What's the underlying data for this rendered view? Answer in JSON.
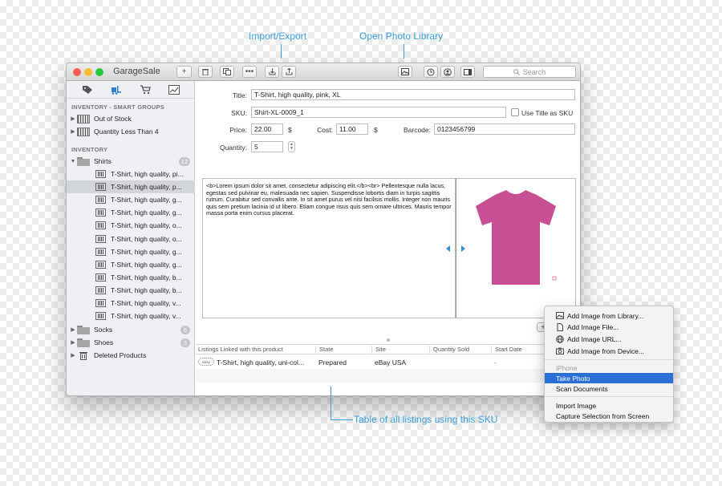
{
  "callouts": {
    "import_export": "Import/Export",
    "open_photo_library": "Open Photo Library",
    "table_of_listings": "Table of all listings using this SKU"
  },
  "window": {
    "app_title": "GarageSale",
    "search_placeholder": "Search",
    "traffic_colors": [
      "#fc5f57",
      "#fdbc2e",
      "#27c840"
    ]
  },
  "sidebar": {
    "smart_groups_header": "INVENTORY - SMART GROUPS",
    "smart_groups": [
      {
        "label": "Out of Stock"
      },
      {
        "label": "Quantity Less Than 4"
      }
    ],
    "inventory_header": "INVENTORY",
    "folders": {
      "shirts": {
        "label": "Shirts",
        "count": "12"
      },
      "socks": {
        "label": "Socks",
        "count": "6"
      },
      "shoes": {
        "label": "Shoes",
        "count": "3"
      },
      "deleted": {
        "label": "Deleted Products"
      }
    },
    "shirt_items": [
      "T-Shirt, high quality, pi...",
      "T-Shirt, high quality, p...",
      "T-Shirt, high quality, g...",
      "T-Shirt, high quality, g...",
      "T-Shirt, high quality, o...",
      "T-Shirt, high quality, o...",
      "T-Shirt, high quality, g...",
      "T-Shirt, high quality, g...",
      "T-Shirt, high quality, b...",
      "T-Shirt, high quality, b...",
      "T-Shirt, high quality, v...",
      "T-Shirt, high quality, v..."
    ]
  },
  "form": {
    "title_label": "Title:",
    "title_value": "T-Shirt, high quality, pink, XL",
    "sku_label": "SKU:",
    "sku_value": "Shirt-XL-0009_1",
    "use_title_as_sku": "Use Title as SKU",
    "price_label": "Price:",
    "price_value": "22.00",
    "currency": "$",
    "cost_label": "Cost:",
    "cost_value": "11.00",
    "barcode_label": "Barcode:",
    "barcode_value": "0123456799",
    "quantity_label": "Quantity:",
    "quantity_value": "5"
  },
  "description": {
    "text": "<b>Lorem ipsum dolor sit amet, consectetur adipiscing elit.</b><br> Pellentesque nulla lacus, egestas sed pulvinar eu, malesuada nec sapien. Suspendisse lobortis diam in turpis sagittis rutrum. Curabitur sed convallis ante. In sit amet purus vel nisi facilisis mollis. Integer non mauris quis sem pretium lacinia id ut libero. Etiam congue risus quis sem ornare ultrices. Mauris tempor massa porta enim cursus placerat."
  },
  "product_image": {
    "color": "#c94f94",
    "description": "pink t-shirt"
  },
  "listings_table": {
    "headers": [
      "Listings Linked with this product",
      "State",
      "Site",
      "Quantity Sold",
      "Start Date"
    ],
    "rows": [
      {
        "icon": "ebay",
        "title": "T-Shirt, high quality, uni-col...",
        "state": "Prepared",
        "site": "eBay USA",
        "quantity_sold": "",
        "start_date": "-"
      }
    ]
  },
  "context_menu": {
    "items_top": [
      {
        "label": "Add Image from Library..."
      },
      {
        "label": "Add Image File..."
      },
      {
        "label": "Add Image URL..."
      },
      {
        "label": "Add Image from Device..."
      }
    ],
    "device_header": "iPhone",
    "device_items": [
      "Take Photo",
      "Scan Documents"
    ],
    "items_bottom": [
      "Import Image",
      "Capture Selection from Screen"
    ]
  },
  "colors": {
    "accent": "#3a9fd6",
    "menu_highlight": "#2a6fd6",
    "sidebar_bg": "#eef0f3"
  }
}
